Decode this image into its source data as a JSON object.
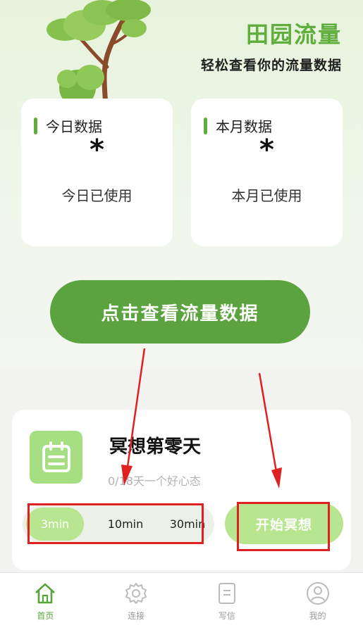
{
  "header": {
    "app_title": "田园流量",
    "subtitle": "轻松查看你的流量数据"
  },
  "stats": [
    {
      "title": "今日数据",
      "value": "*",
      "label": "今日已使用"
    },
    {
      "title": "本月数据",
      "value": "*",
      "label": "本月已使用"
    }
  ],
  "cta_label": "点击查看流量数据",
  "meditation": {
    "title": "冥想第零天",
    "subtitle": "0/18天一个好心态",
    "durations": [
      "3min",
      "10min",
      "30min"
    ],
    "selected_duration": "3min",
    "start_label": "开始冥想"
  },
  "tabbar": [
    {
      "label": "首页",
      "icon": "home-icon",
      "active": true
    },
    {
      "label": "连接",
      "icon": "gear-icon",
      "active": false
    },
    {
      "label": "写信",
      "icon": "letter-icon",
      "active": false
    },
    {
      "label": "我的",
      "icon": "user-icon",
      "active": false
    }
  ],
  "colors": {
    "accent": "#5aa33f",
    "light_accent": "#b8e58f",
    "highlight": "#e02020"
  }
}
